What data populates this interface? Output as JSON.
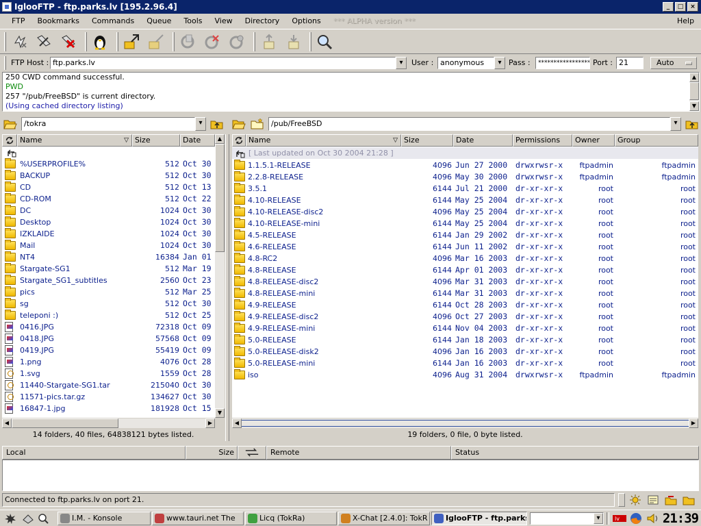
{
  "window": {
    "title": "IglooFTP - ftp.parks.lv [195.2.96.4]"
  },
  "menu": [
    "FTP",
    "Bookmarks",
    "Commands",
    "Queue",
    "Tools",
    "View",
    "Directory",
    "Options"
  ],
  "menu_ghost": "*** ALPHA version ***",
  "menu_help": "Help",
  "connection": {
    "host_label": "FTP Host :",
    "host": "ftp.parks.lv",
    "user_label": "User :",
    "user": "anonymous",
    "pass_label": "Pass :",
    "pass": "******************",
    "port_label": "Port :",
    "port": "21",
    "mode": "Auto"
  },
  "log": [
    {
      "text": "250 CWD command successful.",
      "color": "#000000"
    },
    {
      "text": "PWD",
      "color": "#0a8a0a"
    },
    {
      "text": "257 \"/pub/FreeBSD\" is current directory.",
      "color": "#000000"
    },
    {
      "text": "(Using cached directory listing)",
      "color": "#1a1aa8"
    }
  ],
  "local": {
    "path": "/tokra",
    "headers": [
      "Name",
      "Size",
      "Date"
    ],
    "rows": [
      {
        "t": "folder",
        "name": "%USERPROFILE%",
        "size": "512",
        "date": "Oct 30"
      },
      {
        "t": "folder",
        "name": "BACKUP",
        "size": "512",
        "date": "Oct 30"
      },
      {
        "t": "folder",
        "name": "CD",
        "size": "512",
        "date": "Oct 13"
      },
      {
        "t": "folder",
        "name": "CD-ROM",
        "size": "512",
        "date": "Oct 22"
      },
      {
        "t": "folder",
        "name": "DC",
        "size": "1024",
        "date": "Oct 30"
      },
      {
        "t": "folder",
        "name": "Desktop",
        "size": "1024",
        "date": "Oct 30"
      },
      {
        "t": "folder",
        "name": "IZKLAIDE",
        "size": "1024",
        "date": "Oct 30"
      },
      {
        "t": "folder",
        "name": "Mail",
        "size": "1024",
        "date": "Oct 30"
      },
      {
        "t": "folder",
        "name": "NT4",
        "size": "16384",
        "date": "Jan 01"
      },
      {
        "t": "folder",
        "name": "Stargate-SG1",
        "size": "512",
        "date": "Mar 19"
      },
      {
        "t": "folder",
        "name": "Stargate_SG1_subtitles",
        "size": "2560",
        "date": "Oct 23"
      },
      {
        "t": "folder",
        "name": "pics",
        "size": "512",
        "date": "Mar 25"
      },
      {
        "t": "folder",
        "name": "sg",
        "size": "512",
        "date": "Oct 30"
      },
      {
        "t": "folder",
        "name": "teleponi :)",
        "size": "512",
        "date": "Oct 25"
      },
      {
        "t": "img",
        "name": "0416.JPG",
        "size": "72318",
        "date": "Oct 09"
      },
      {
        "t": "img",
        "name": "0418.JPG",
        "size": "57568",
        "date": "Oct 09"
      },
      {
        "t": "img",
        "name": "0419.JPG",
        "size": "55419",
        "date": "Oct 09"
      },
      {
        "t": "img",
        "name": "1.png",
        "size": "4076",
        "date": "Oct 28"
      },
      {
        "t": "doc",
        "name": "1.svg",
        "size": "1559",
        "date": "Oct 28"
      },
      {
        "t": "doc",
        "name": "11440-Stargate-SG1.tar",
        "size": "215040",
        "date": "Oct 30"
      },
      {
        "t": "doc",
        "name": "11571-pics.tar.gz",
        "size": "134627",
        "date": "Oct 30"
      },
      {
        "t": "img",
        "name": "16847-1.jpg",
        "size": "181928",
        "date": "Oct 15"
      }
    ],
    "status": "14 folders, 40 files, 64838121 bytes listed."
  },
  "remote": {
    "path": "/pub/FreeBSD",
    "headers": [
      "Name",
      "Size",
      "Date",
      "Permissions",
      "Owner",
      "Group"
    ],
    "updated": "[ Last updated on Oct 30 2004 21:28 ]",
    "rows": [
      {
        "name": "1.1.5.1-RELEASE",
        "size": "4096",
        "date": "Jun 27 2000",
        "perm": "drwxrwsr-x",
        "owner": "ftpadmin",
        "group": "ftpadmin"
      },
      {
        "name": "2.2.8-RELEASE",
        "size": "4096",
        "date": "May 30 2000",
        "perm": "drwxrwsr-x",
        "owner": "ftpadmin",
        "group": "ftpadmin"
      },
      {
        "name": "3.5.1",
        "size": "6144",
        "date": "Jul 21 2000",
        "perm": "dr-xr-xr-x",
        "owner": "root",
        "group": "root"
      },
      {
        "name": "4.10-RELEASE",
        "size": "6144",
        "date": "May 25 2004",
        "perm": "dr-xr-xr-x",
        "owner": "root",
        "group": "root"
      },
      {
        "name": "4.10-RELEASE-disc2",
        "size": "4096",
        "date": "May 25 2004",
        "perm": "dr-xr-xr-x",
        "owner": "root",
        "group": "root"
      },
      {
        "name": "4.10-RELEASE-mini",
        "size": "6144",
        "date": "May 25 2004",
        "perm": "dr-xr-xr-x",
        "owner": "root",
        "group": "root"
      },
      {
        "name": "4.5-RELEASE",
        "size": "6144",
        "date": "Jan 29 2002",
        "perm": "dr-xr-xr-x",
        "owner": "root",
        "group": "root"
      },
      {
        "name": "4.6-RELEASE",
        "size": "6144",
        "date": "Jun 11 2002",
        "perm": "dr-xr-xr-x",
        "owner": "root",
        "group": "root"
      },
      {
        "name": "4.8-RC2",
        "size": "4096",
        "date": "Mar 16 2003",
        "perm": "dr-xr-xr-x",
        "owner": "root",
        "group": "root"
      },
      {
        "name": "4.8-RELEASE",
        "size": "6144",
        "date": "Apr 01 2003",
        "perm": "dr-xr-xr-x",
        "owner": "root",
        "group": "root"
      },
      {
        "name": "4.8-RELEASE-disc2",
        "size": "4096",
        "date": "Mar 31 2003",
        "perm": "dr-xr-xr-x",
        "owner": "root",
        "group": "root"
      },
      {
        "name": "4.8-RELEASE-mini",
        "size": "6144",
        "date": "Mar 31 2003",
        "perm": "dr-xr-xr-x",
        "owner": "root",
        "group": "root"
      },
      {
        "name": "4.9-RELEASE",
        "size": "6144",
        "date": "Oct 28 2003",
        "perm": "dr-xr-xr-x",
        "owner": "root",
        "group": "root"
      },
      {
        "name": "4.9-RELEASE-disc2",
        "size": "4096",
        "date": "Oct 27 2003",
        "perm": "dr-xr-xr-x",
        "owner": "root",
        "group": "root"
      },
      {
        "name": "4.9-RELEASE-mini",
        "size": "6144",
        "date": "Nov 04 2003",
        "perm": "dr-xr-xr-x",
        "owner": "root",
        "group": "root"
      },
      {
        "name": "5.0-RELEASE",
        "size": "6144",
        "date": "Jan 18 2003",
        "perm": "dr-xr-xr-x",
        "owner": "root",
        "group": "root"
      },
      {
        "name": "5.0-RELEASE-disk2",
        "size": "4096",
        "date": "Jan 16 2003",
        "perm": "dr-xr-xr-x",
        "owner": "root",
        "group": "root"
      },
      {
        "name": "5.0-RELEASE-mini",
        "size": "6144",
        "date": "Jan 16 2003",
        "perm": "dr-xr-xr-x",
        "owner": "root",
        "group": "root"
      },
      {
        "name": "iso",
        "size": "4096",
        "date": "Aug 31 2004",
        "perm": "drwxrwsr-x",
        "owner": "ftpadmin",
        "group": "ftpadmin"
      }
    ],
    "status": "19 folders, 0 file, 0 byte listed."
  },
  "queue": {
    "headers": [
      "Local",
      "Size",
      "Remote",
      "Status"
    ]
  },
  "statusbar": "Connected to ftp.parks.lv on port 21.",
  "taskbar": {
    "tasks": [
      "I.M. - Konsole",
      "www.tauri.net The",
      "Licq (TokRa)",
      "X-Chat [2.4.0]: TokR",
      "IglooFTP - ftp.parks"
    ],
    "clock": "21:39"
  },
  "colors": {
    "titlebar": "#0a246a",
    "list_text": "#0a1e8c",
    "chrome": "#d4d0c8"
  }
}
